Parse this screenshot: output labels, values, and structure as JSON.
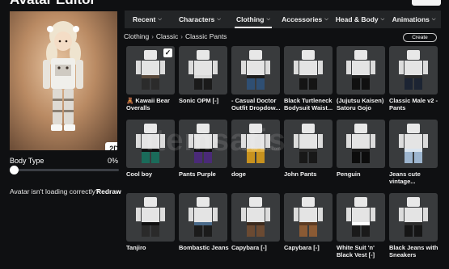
{
  "window": {
    "title": "Avatar Editor"
  },
  "preview": {
    "view_toggle": "2D"
  },
  "body_type": {
    "label": "Body Type",
    "value": "0%",
    "level": 0
  },
  "help": {
    "text": "Avatar isn't loading correctly?",
    "redraw": "Redraw"
  },
  "tabs": [
    {
      "label": "Recent",
      "active": false
    },
    {
      "label": "Characters",
      "active": false
    },
    {
      "label": "Clothing",
      "active": true
    },
    {
      "label": "Accessories",
      "active": false
    },
    {
      "label": "Head & Body",
      "active": false
    },
    {
      "label": "Animations",
      "active": false
    }
  ],
  "breadcrumb": {
    "items": [
      "Clothing",
      "Classic",
      "Classic Pants"
    ]
  },
  "create_label": "Create",
  "watermark": {
    "text": "itemsatis",
    "sub": "www.itemsatis.com"
  },
  "items": [
    {
      "name": "🧸 Kawaii Bear Overalls",
      "selected": true,
      "pants": "#2b2b2b",
      "detail": "#5a4a3c"
    },
    {
      "name": "Sonic OPM [-]",
      "selected": false,
      "pants": "#1a1a1a",
      "detail": "#d9d9d9"
    },
    {
      "name": "- Casual Doctor Outfit Dropdow...",
      "selected": false,
      "pants": "#2f4f73",
      "detail": "#1d1d1d"
    },
    {
      "name": "Black Turtleneck Bodysuit Waist...",
      "selected": false,
      "pants": "#141414",
      "detail": "#3a3a3a"
    },
    {
      "name": "(Jujutsu Kaisen) Satoru Gojo",
      "selected": false,
      "pants": "#101010",
      "detail": "#202020"
    },
    {
      "name": "Classic Male v2 - Pants",
      "selected": false,
      "pants": "#1c2433",
      "detail": "#2a2a2a"
    },
    {
      "name": "Cool boy",
      "selected": false,
      "pants": "#1a6b5a",
      "detail": "#111111"
    },
    {
      "name": "Pants Purple",
      "selected": false,
      "pants": "#4a2a78",
      "detail": "#111111"
    },
    {
      "name": "doge",
      "selected": false,
      "pants": "#c8921e",
      "detail": "#e0b040"
    },
    {
      "name": "John Pants",
      "selected": false,
      "pants": "#181818",
      "detail": "#2a2a2a"
    },
    {
      "name": "Penguin",
      "selected": false,
      "pants": "#0c0c0c",
      "detail": "#1a1a1a"
    },
    {
      "name": "Jeans cute vintage...",
      "selected": false,
      "pants": "#9db5cf",
      "detail": "#d9e4ef"
    },
    {
      "name": "Tanjiro",
      "selected": false,
      "pants": "#2a2a2a",
      "detail": "#111111"
    },
    {
      "name": "Bombastic Jeans",
      "selected": false,
      "pants": "#1b1b1b",
      "detail": "#4a6a8a"
    },
    {
      "name": "Capybara [-]",
      "selected": false,
      "pants": "#6b4a32",
      "detail": "#3b2a1e"
    },
    {
      "name": "Capybara [-]",
      "selected": false,
      "pants": "#8a5a34",
      "detail": "#5b3a22"
    },
    {
      "name": "White Suit 'n' Black Vest [-]",
      "selected": false,
      "pants": "#1a1a1a",
      "detail": "#ffffff"
    },
    {
      "name": "Black Jeans with Sneakers",
      "selected": false,
      "pants": "#151515",
      "detail": "#2c2c2c"
    }
  ],
  "colors": {
    "background": "#0f1012",
    "tab_bar": "#232527",
    "thumb": "#393b3d"
  }
}
